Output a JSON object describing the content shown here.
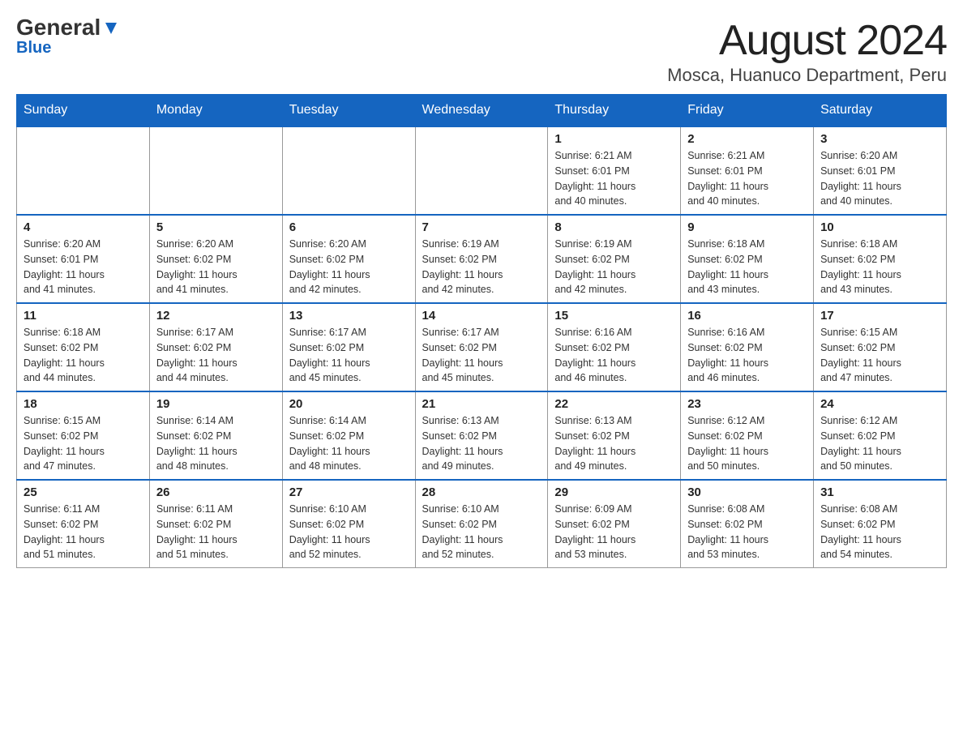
{
  "header": {
    "logo_general": "General",
    "logo_blue": "Blue",
    "month_title": "August 2024",
    "location": "Mosca, Huanuco Department, Peru"
  },
  "days_of_week": [
    "Sunday",
    "Monday",
    "Tuesday",
    "Wednesday",
    "Thursday",
    "Friday",
    "Saturday"
  ],
  "weeks": [
    {
      "days": [
        {
          "number": "",
          "info": ""
        },
        {
          "number": "",
          "info": ""
        },
        {
          "number": "",
          "info": ""
        },
        {
          "number": "",
          "info": ""
        },
        {
          "number": "1",
          "info": "Sunrise: 6:21 AM\nSunset: 6:01 PM\nDaylight: 11 hours\nand 40 minutes."
        },
        {
          "number": "2",
          "info": "Sunrise: 6:21 AM\nSunset: 6:01 PM\nDaylight: 11 hours\nand 40 minutes."
        },
        {
          "number": "3",
          "info": "Sunrise: 6:20 AM\nSunset: 6:01 PM\nDaylight: 11 hours\nand 40 minutes."
        }
      ]
    },
    {
      "days": [
        {
          "number": "4",
          "info": "Sunrise: 6:20 AM\nSunset: 6:01 PM\nDaylight: 11 hours\nand 41 minutes."
        },
        {
          "number": "5",
          "info": "Sunrise: 6:20 AM\nSunset: 6:02 PM\nDaylight: 11 hours\nand 41 minutes."
        },
        {
          "number": "6",
          "info": "Sunrise: 6:20 AM\nSunset: 6:02 PM\nDaylight: 11 hours\nand 42 minutes."
        },
        {
          "number": "7",
          "info": "Sunrise: 6:19 AM\nSunset: 6:02 PM\nDaylight: 11 hours\nand 42 minutes."
        },
        {
          "number": "8",
          "info": "Sunrise: 6:19 AM\nSunset: 6:02 PM\nDaylight: 11 hours\nand 42 minutes."
        },
        {
          "number": "9",
          "info": "Sunrise: 6:18 AM\nSunset: 6:02 PM\nDaylight: 11 hours\nand 43 minutes."
        },
        {
          "number": "10",
          "info": "Sunrise: 6:18 AM\nSunset: 6:02 PM\nDaylight: 11 hours\nand 43 minutes."
        }
      ]
    },
    {
      "days": [
        {
          "number": "11",
          "info": "Sunrise: 6:18 AM\nSunset: 6:02 PM\nDaylight: 11 hours\nand 44 minutes."
        },
        {
          "number": "12",
          "info": "Sunrise: 6:17 AM\nSunset: 6:02 PM\nDaylight: 11 hours\nand 44 minutes."
        },
        {
          "number": "13",
          "info": "Sunrise: 6:17 AM\nSunset: 6:02 PM\nDaylight: 11 hours\nand 45 minutes."
        },
        {
          "number": "14",
          "info": "Sunrise: 6:17 AM\nSunset: 6:02 PM\nDaylight: 11 hours\nand 45 minutes."
        },
        {
          "number": "15",
          "info": "Sunrise: 6:16 AM\nSunset: 6:02 PM\nDaylight: 11 hours\nand 46 minutes."
        },
        {
          "number": "16",
          "info": "Sunrise: 6:16 AM\nSunset: 6:02 PM\nDaylight: 11 hours\nand 46 minutes."
        },
        {
          "number": "17",
          "info": "Sunrise: 6:15 AM\nSunset: 6:02 PM\nDaylight: 11 hours\nand 47 minutes."
        }
      ]
    },
    {
      "days": [
        {
          "number": "18",
          "info": "Sunrise: 6:15 AM\nSunset: 6:02 PM\nDaylight: 11 hours\nand 47 minutes."
        },
        {
          "number": "19",
          "info": "Sunrise: 6:14 AM\nSunset: 6:02 PM\nDaylight: 11 hours\nand 48 minutes."
        },
        {
          "number": "20",
          "info": "Sunrise: 6:14 AM\nSunset: 6:02 PM\nDaylight: 11 hours\nand 48 minutes."
        },
        {
          "number": "21",
          "info": "Sunrise: 6:13 AM\nSunset: 6:02 PM\nDaylight: 11 hours\nand 49 minutes."
        },
        {
          "number": "22",
          "info": "Sunrise: 6:13 AM\nSunset: 6:02 PM\nDaylight: 11 hours\nand 49 minutes."
        },
        {
          "number": "23",
          "info": "Sunrise: 6:12 AM\nSunset: 6:02 PM\nDaylight: 11 hours\nand 50 minutes."
        },
        {
          "number": "24",
          "info": "Sunrise: 6:12 AM\nSunset: 6:02 PM\nDaylight: 11 hours\nand 50 minutes."
        }
      ]
    },
    {
      "days": [
        {
          "number": "25",
          "info": "Sunrise: 6:11 AM\nSunset: 6:02 PM\nDaylight: 11 hours\nand 51 minutes."
        },
        {
          "number": "26",
          "info": "Sunrise: 6:11 AM\nSunset: 6:02 PM\nDaylight: 11 hours\nand 51 minutes."
        },
        {
          "number": "27",
          "info": "Sunrise: 6:10 AM\nSunset: 6:02 PM\nDaylight: 11 hours\nand 52 minutes."
        },
        {
          "number": "28",
          "info": "Sunrise: 6:10 AM\nSunset: 6:02 PM\nDaylight: 11 hours\nand 52 minutes."
        },
        {
          "number": "29",
          "info": "Sunrise: 6:09 AM\nSunset: 6:02 PM\nDaylight: 11 hours\nand 53 minutes."
        },
        {
          "number": "30",
          "info": "Sunrise: 6:08 AM\nSunset: 6:02 PM\nDaylight: 11 hours\nand 53 minutes."
        },
        {
          "number": "31",
          "info": "Sunrise: 6:08 AM\nSunset: 6:02 PM\nDaylight: 11 hours\nand 54 minutes."
        }
      ]
    }
  ]
}
